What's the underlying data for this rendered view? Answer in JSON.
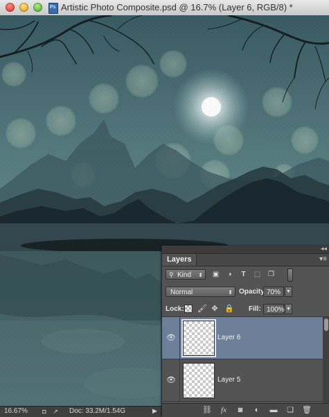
{
  "window": {
    "title": "Artistic Photo Composite.psd @ 16.7% (Layer 6, RGB/8) *",
    "file_icon": "psd-file-icon"
  },
  "status_bar": {
    "zoom": "16.67%",
    "doc_info": "Doc: 33.2M/1.54G"
  },
  "layers_panel": {
    "tab_label": "Layers",
    "filter": {
      "kind_label": "Kind"
    },
    "blend_mode": "Normal",
    "opacity_label": "Opacity:",
    "opacity_value": "70%",
    "lock_label": "Lock:",
    "fill_label": "Fill:",
    "fill_value": "100%",
    "layers": [
      {
        "name": "Layer 6",
        "visible": true,
        "selected": true
      },
      {
        "name": "Layer 5",
        "visible": true,
        "selected": false
      }
    ],
    "footer_icons": [
      "link-layers-icon",
      "fx-icon",
      "add-mask-icon",
      "adjustment-layer-icon",
      "new-group-icon",
      "new-layer-icon",
      "trash-icon"
    ]
  },
  "colors": {
    "selection": "#6e7f99",
    "panel_bg": "#535353",
    "sky": "#4d6e74"
  }
}
